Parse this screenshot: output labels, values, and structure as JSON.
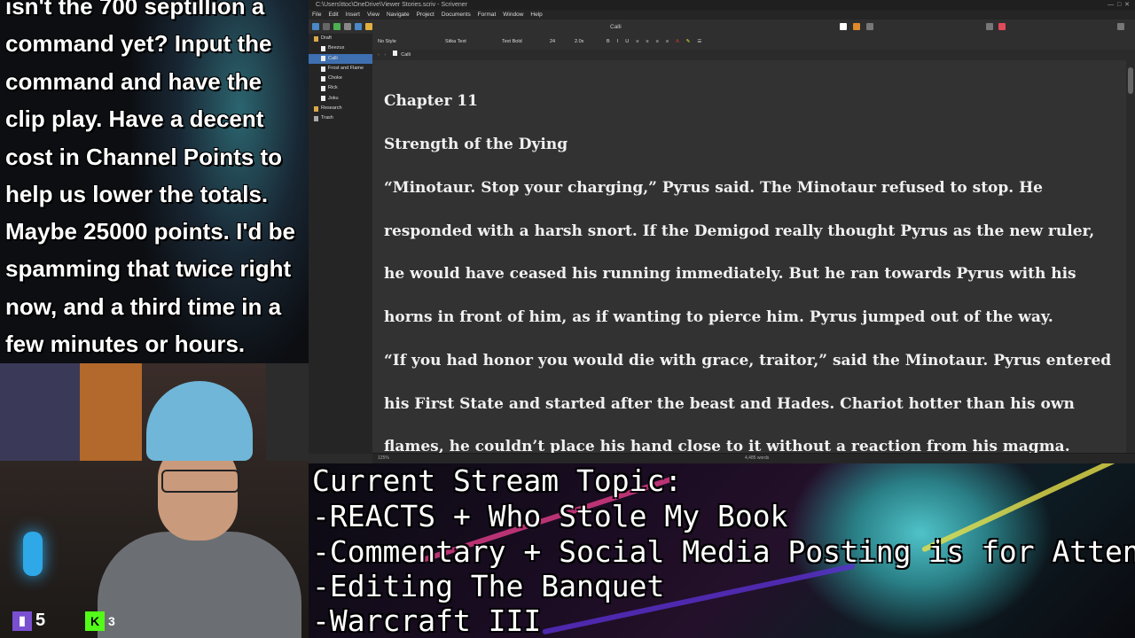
{
  "chat": {
    "lines": [
      "isn't the 700 septillion a",
      "command yet? Input the",
      "command and have the",
      "clip play. Have a decent",
      "cost in Channel Points to",
      "help us lower the totals.",
      "Maybe 25000 points. I'd be",
      "spamming that twice right",
      "now, and a third time in a",
      "few minutes or hours."
    ]
  },
  "cam": {
    "badges": [
      {
        "icon": "purple-icon",
        "count": "5",
        "color": "#7a4fd0"
      },
      {
        "icon": "kick-icon",
        "letter": "K",
        "count": "3",
        "color": "#53fc18"
      }
    ]
  },
  "app": {
    "window_title": "C:\\Users\\ttoc\\OneDrive\\Viewer Stories.scriv - Scrivener",
    "menu": [
      "File",
      "Edit",
      "Insert",
      "View",
      "Navigate",
      "Project",
      "Documents",
      "Format",
      "Window",
      "Help"
    ],
    "toolbar_center": "Calli",
    "binder": [
      {
        "label": "Draft",
        "kind": "folder"
      },
      {
        "label": "Beezus",
        "kind": "doc"
      },
      {
        "label": "Calli",
        "kind": "doc",
        "selected": true
      },
      {
        "label": "Frost and Flame",
        "kind": "doc"
      },
      {
        "label": "Choke",
        "kind": "doc"
      },
      {
        "label": "Rick",
        "kind": "doc"
      },
      {
        "label": "Joku",
        "kind": "doc"
      },
      {
        "label": "Research",
        "kind": "folder"
      },
      {
        "label": "Trash",
        "kind": "trash"
      }
    ],
    "format": {
      "style": "No Style",
      "font": "Sitka Text",
      "weight": "Text Bold",
      "size": "24",
      "spacing": "2.0x"
    },
    "header_title": "Calli",
    "document": [
      "Chapter 11",
      "Strength of the Dying",
      "“Minotaur. Stop your charging,” Pyrus said. The Minotaur refused to stop. He",
      "responded with a harsh snort. If the Demigod really thought Pyrus as the new ruler,",
      "he would have ceased his running immediately. But he ran towards Pyrus with his",
      "horns in front of him, as if wanting to pierce him. Pyrus jumped out of the way.",
      "“If you had honor you would die with grace, traitor,” said the Minotaur. Pyrus entered",
      "his First State and started after the beast and Hades. Chariot hotter than his own",
      "flames, he couldn’t place his hand close to it without a reaction from his magma."
    ],
    "footer": {
      "zoom": "125%",
      "word_count": "4,485 words"
    }
  },
  "topic": {
    "lines": [
      "Current Stream Topic:",
      "-REACTS + Who Stole My Book",
      "-Commentary + Social Media Posting is for Atten",
      "-Editing The Banquet",
      "-Warcraft III"
    ]
  }
}
